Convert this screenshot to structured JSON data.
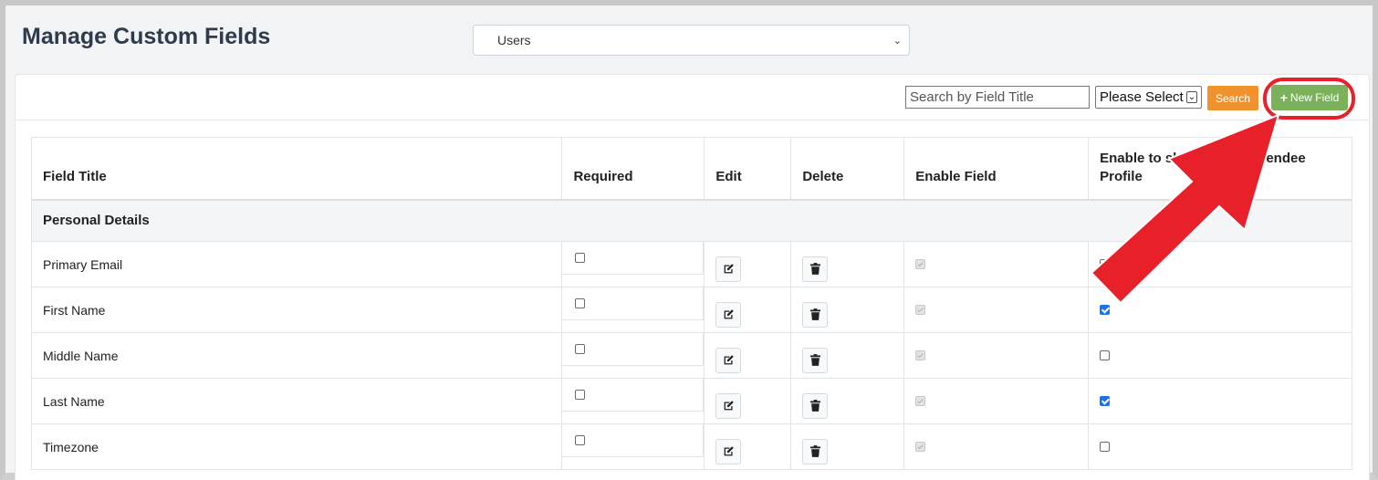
{
  "page": {
    "title": "Manage Custom Fields",
    "module_select_value": "Users"
  },
  "toolbar": {
    "search_placeholder": "Search by Field Title",
    "filter_value": "Please Select",
    "search_label": "Search",
    "new_field_label": "New Field"
  },
  "table": {
    "headers": [
      "Field Title",
      "Required",
      "Edit",
      "Delete",
      "Enable Field",
      "Enable to show in Attendee Profile"
    ],
    "header_visible": {
      "enable_profile": "Enable to sh",
      "enable_profile_tail": "tendee",
      "enable_profile_line2": "Profile"
    },
    "group": "Personal Details",
    "rows": [
      {
        "title": "Primary Email",
        "required": false,
        "enable_field": true,
        "show_profile": false
      },
      {
        "title": "First Name",
        "required": false,
        "enable_field": true,
        "show_profile": true
      },
      {
        "title": "Middle Name",
        "required": false,
        "enable_field": true,
        "show_profile": false
      },
      {
        "title": "Last Name",
        "required": false,
        "enable_field": true,
        "show_profile": true
      },
      {
        "title": "Timezone",
        "required": false,
        "enable_field": true,
        "show_profile": false
      }
    ]
  },
  "colors": {
    "search_button": "#f0922e",
    "new_field_button": "#7cb15c",
    "highlight": "#e8202a",
    "checkbox_checked": "#1a73e8"
  },
  "icons": [
    "chevron-down-icon",
    "plus-icon",
    "edit-icon",
    "trash-icon",
    "arrow-pointer-icon"
  ]
}
